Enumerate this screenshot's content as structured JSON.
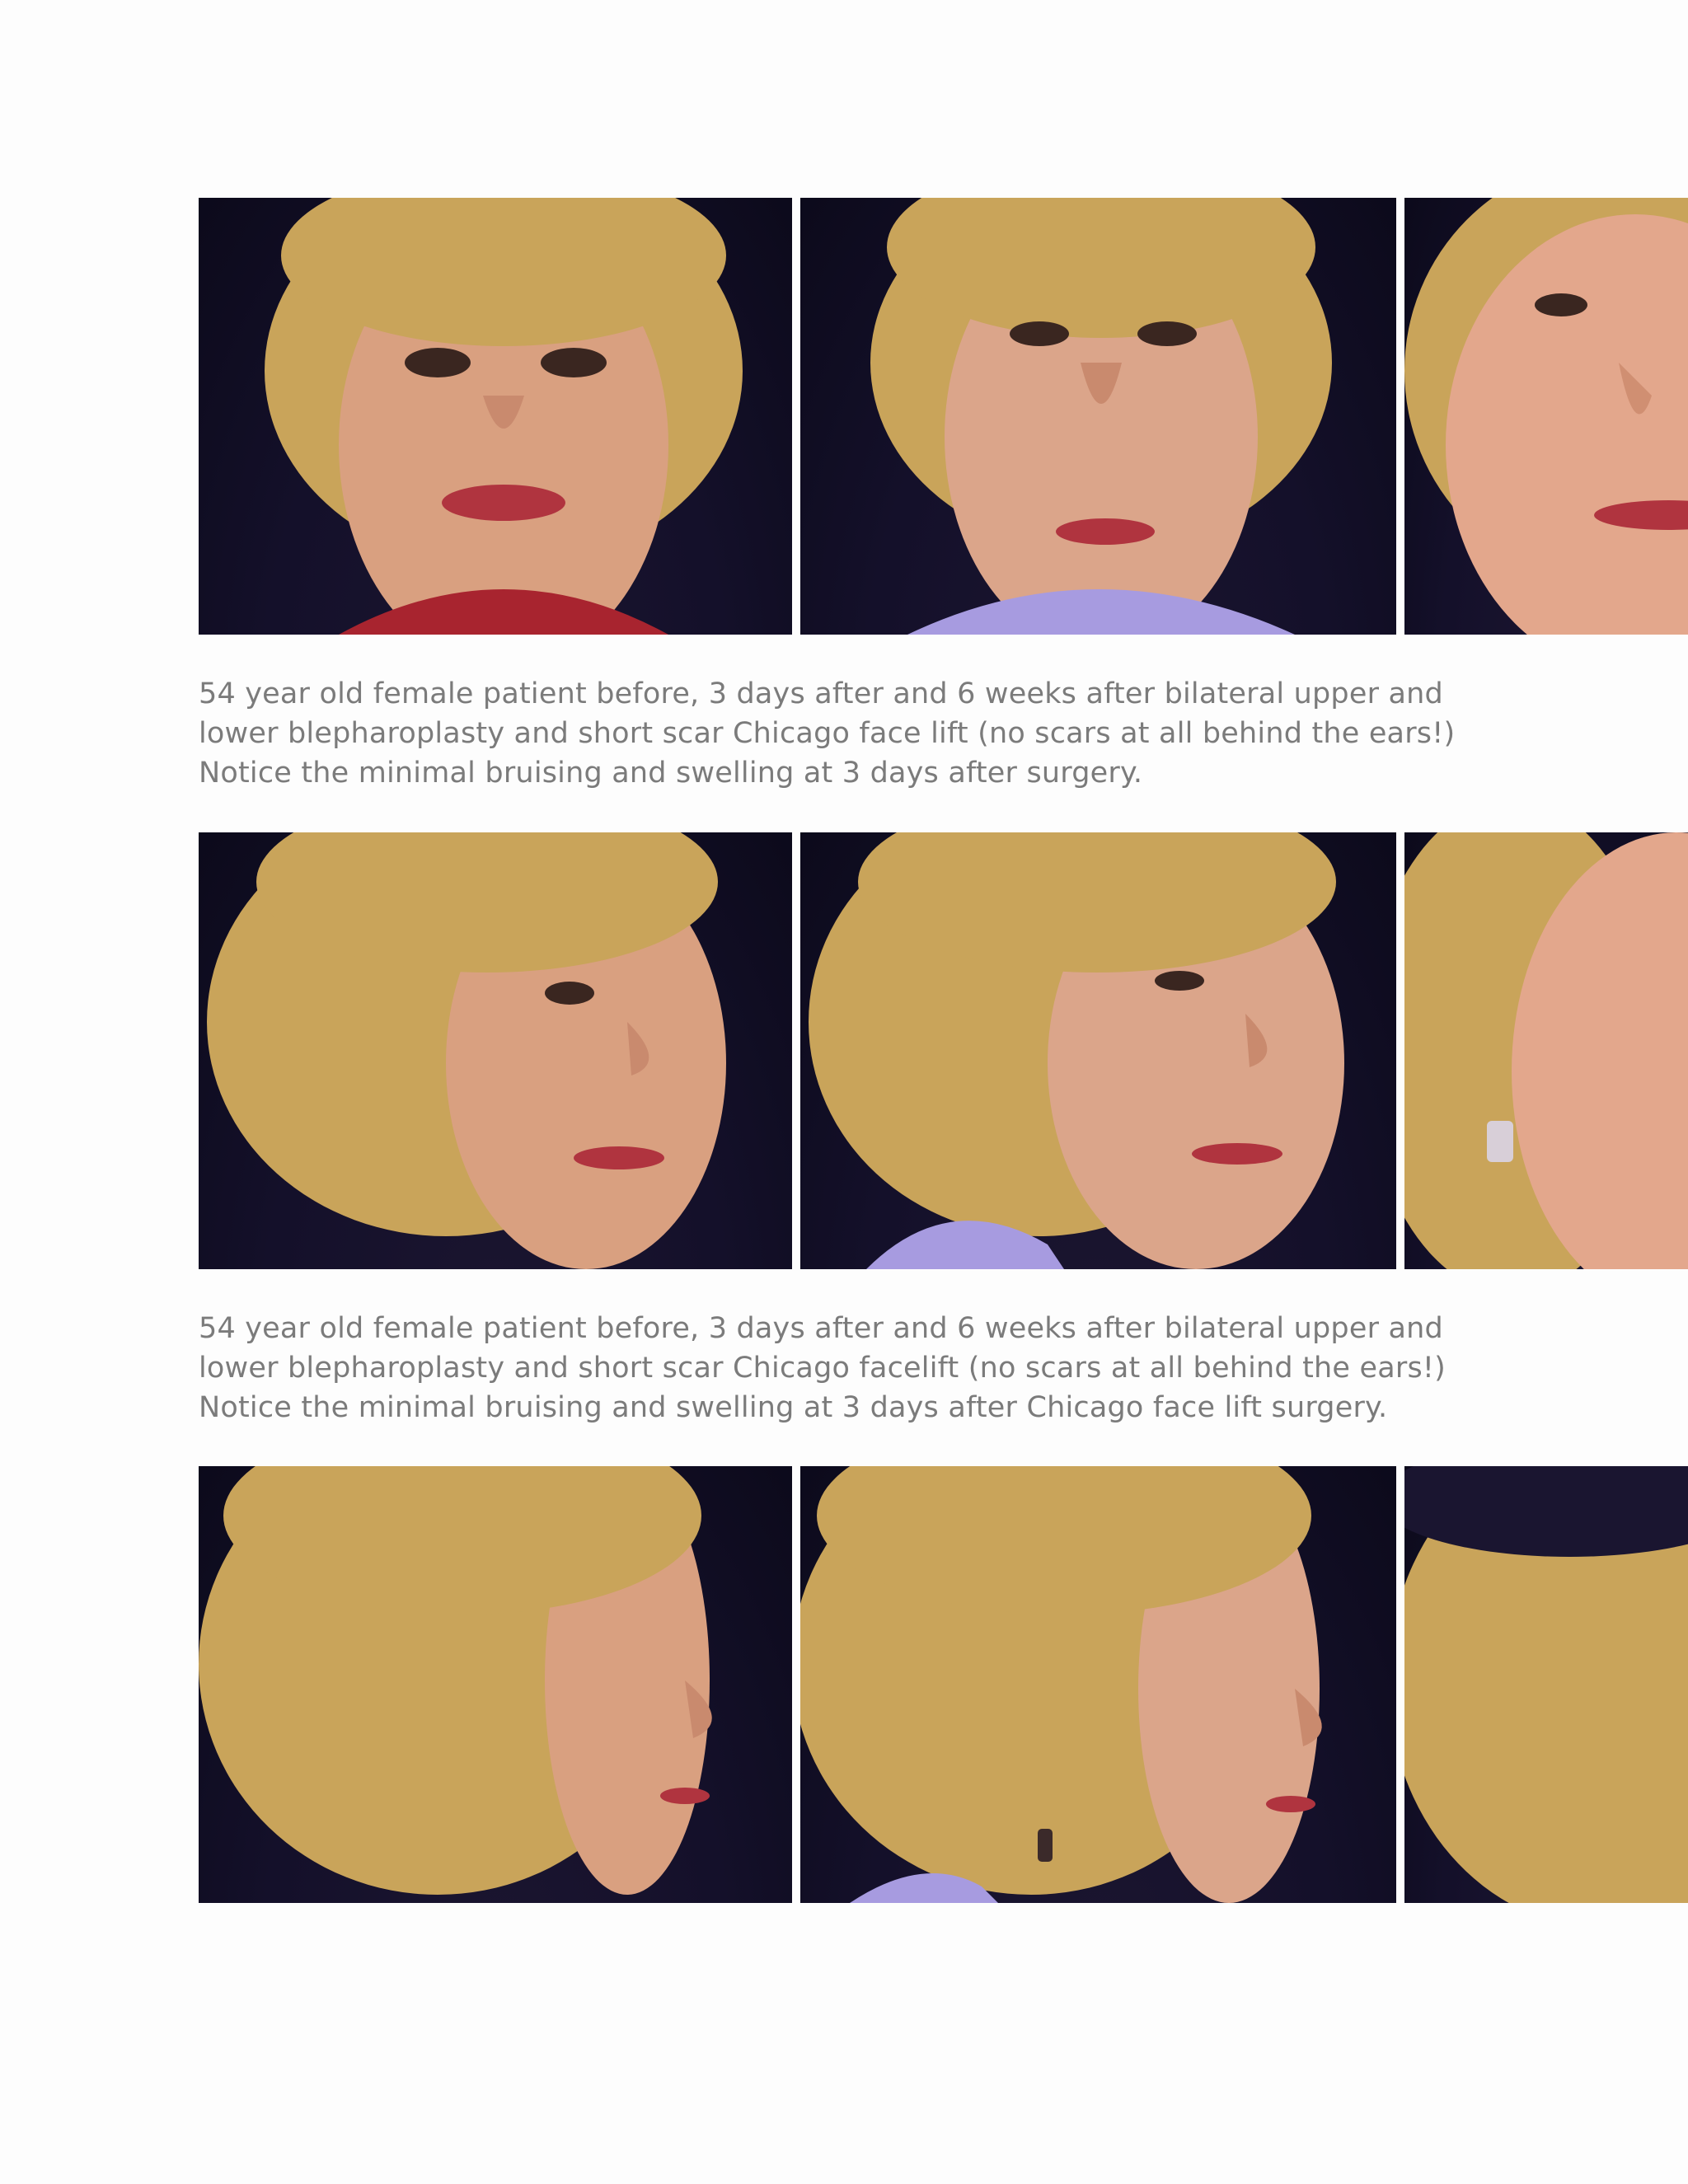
{
  "captions": [
    "54 year old female patient before, 3 days after and 6 weeks after bilateral upper and lower blepharoplasty and short scar Chicago face lift (no scars at all behind the ears!) Notice the minimal bruising and swelling at 3 days after surgery.",
    "54 year old female patient before, 3 days after and 6 weeks after bilateral upper and lower blepharoplasty and short scar Chicago facelift (no scars at all behind the ears!) Notice the minimal bruising and swelling at 3 days after Chicago face lift surgery."
  ],
  "colors": {
    "background": "#fdfdfd",
    "caption_text": "#7b7b7b",
    "photo_backdrop": "#14102a",
    "hair": "#c9a45a",
    "skin": "#d9a080",
    "lips": "#b0343f",
    "blouse_before": "#a8242f",
    "blouse_after": "#a79be0"
  }
}
